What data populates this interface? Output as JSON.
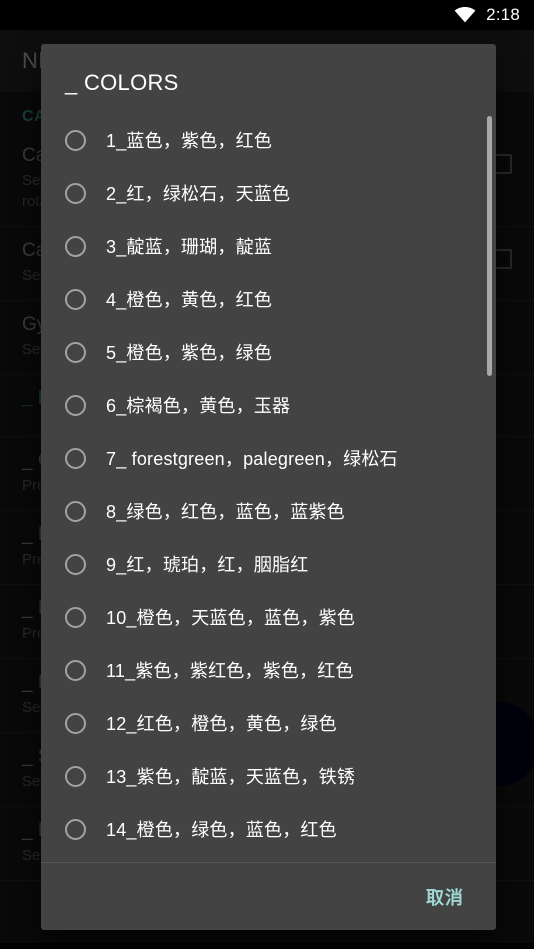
{
  "status_bar": {
    "wifi_icon": "wifi-icon",
    "time": "2:18"
  },
  "background_app": {
    "app_bar_title": "NE",
    "sections": [
      {
        "header": "CA",
        "rows": [
          {
            "title": "Ca",
            "subtitle": "Set\nrota",
            "checkbox": true
          },
          {
            "title": "Ca",
            "subtitle": "Set",
            "checkbox": true
          }
        ]
      }
    ],
    "rows": [
      {
        "title": "Gy",
        "subtitle": "Set",
        "checkbox": false,
        "teal": false
      },
      {
        "title": "_ N",
        "subtitle": "",
        "checkbox": false,
        "teal": true
      },
      {
        "title": "_ O",
        "subtitle": "Pre",
        "checkbox": false,
        "teal": false
      },
      {
        "title": "_ B",
        "subtitle": "Pre",
        "checkbox": false,
        "teal": false
      },
      {
        "title": "_ M",
        "subtitle": "Pre",
        "checkbox": false,
        "teal": false
      },
      {
        "title": "_ B",
        "subtitle": "Set",
        "checkbox": false,
        "teal": false
      },
      {
        "title": "_ S",
        "subtitle": "Set",
        "checkbox": false,
        "teal": false
      },
      {
        "title": "_ R",
        "subtitle": "Set",
        "checkbox": false,
        "teal": false
      }
    ],
    "fab": "floating-action-button"
  },
  "dialog": {
    "title": "_ COLORS",
    "selected_index": -1,
    "options": [
      "1_蓝色，紫色，红色",
      "2_红，绿松石，天蓝色",
      "3_靛蓝，珊瑚，靛蓝",
      "4_橙色，黄色，红色",
      "5_橙色，紫色，绿色",
      "6_棕褐色，黄色，玉器",
      "7_ forestgreen，palegreen，绿松石",
      "8_绿色，红色，蓝色，蓝紫色",
      "9_红，琥珀，红，胭脂红",
      "10_橙色，天蓝色，蓝色，紫色",
      "11_紫色，紫红色，紫色，红色",
      "12_红色，橙色，黄色，绿色",
      "13_紫色，靛蓝，天蓝色，铁锈",
      "14_橙色，绿色，蓝色，红色"
    ],
    "cancel_label": "取消",
    "accent_color": "#9fd8d2",
    "surface_color": "#434343"
  }
}
